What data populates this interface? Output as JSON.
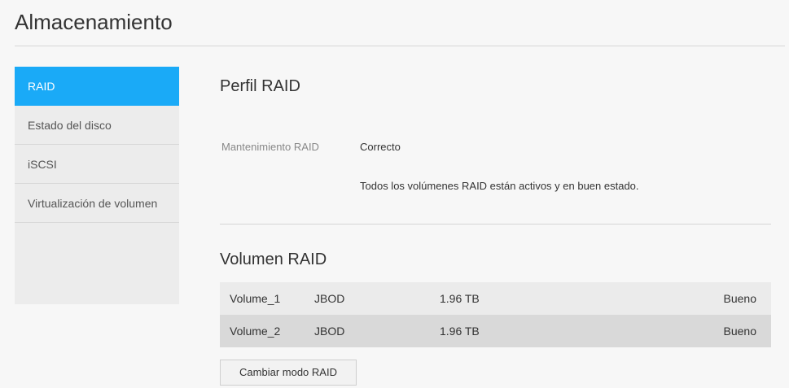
{
  "page": {
    "title": "Almacenamiento"
  },
  "sidebar": {
    "items": [
      {
        "label": "RAID",
        "active": true
      },
      {
        "label": "Estado del disco",
        "active": false
      },
      {
        "label": "iSCSI",
        "active": false
      },
      {
        "label": "Virtualización de volumen",
        "active": false
      }
    ]
  },
  "perfil": {
    "title": "Perfil RAID",
    "maintenance_label": "Mantenimiento RAID",
    "maintenance_value": "Correcto",
    "maintenance_description": "Todos los volúmenes RAID están activos y en buen estado."
  },
  "volumen": {
    "title": "Volumen RAID",
    "rows": [
      {
        "name": "Volume_1",
        "type": "JBOD",
        "size": "1.96 TB",
        "status": "Bueno"
      },
      {
        "name": "Volume_2",
        "type": "JBOD",
        "size": "1.96 TB",
        "status": "Bueno"
      }
    ],
    "change_button_label": "Cambiar modo RAID"
  },
  "colors": {
    "accent": "#1aaaf7",
    "sidebar_bg": "#ececec",
    "row_odd": "#ebebeb",
    "row_even": "#d9d9d9"
  }
}
